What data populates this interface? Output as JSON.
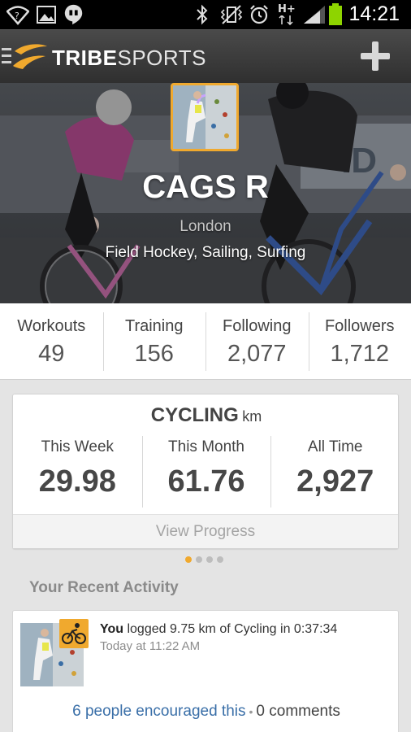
{
  "status_bar": {
    "time": "14:21",
    "left_icons": [
      "wifi-question-icon",
      "image-icon",
      "hangouts-icon"
    ],
    "right_icons": [
      "bluetooth-icon",
      "vibrate-icon",
      "alarm-icon",
      "hplus-data-icon",
      "signal-icon",
      "battery-icon"
    ],
    "network_label": "H+"
  },
  "app_bar": {
    "brand_part1": "TRIBE",
    "brand_part2": "SPORTS",
    "add_icon": "plus-icon",
    "menu_icon": "hamburger-icon"
  },
  "profile": {
    "name": "CAGS R",
    "location": "London",
    "sports": "Field Hockey, Sailing, Surfing"
  },
  "stats": [
    {
      "label": "Workouts",
      "value": "49"
    },
    {
      "label": "Training",
      "value": "156"
    },
    {
      "label": "Following",
      "value": "2,077"
    },
    {
      "label": "Followers",
      "value": "1,712"
    }
  ],
  "cycling_card": {
    "sport": "CYCLING",
    "unit": "km",
    "columns": [
      {
        "label": "This Week",
        "value": "29.98"
      },
      {
        "label": "This Month",
        "value": "61.76"
      },
      {
        "label": "All Time",
        "value": "2,927"
      }
    ],
    "view_progress": "View Progress"
  },
  "pager": {
    "active": 1,
    "total": 4
  },
  "recent_activity": {
    "title": "Your Recent Activity",
    "items": [
      {
        "actor": "You",
        "text": " logged 9.75 km of Cycling in 0:37:34",
        "time": "Today at 11:22 AM",
        "badge_icon": "cycling-icon",
        "encouraged": "6 people encouraged this",
        "separator": "•",
        "comments": "0 comments"
      }
    ]
  },
  "colors": {
    "accent": "#f0a92e",
    "link": "#3a6fa8",
    "app_bar": "#3b3b3b"
  }
}
